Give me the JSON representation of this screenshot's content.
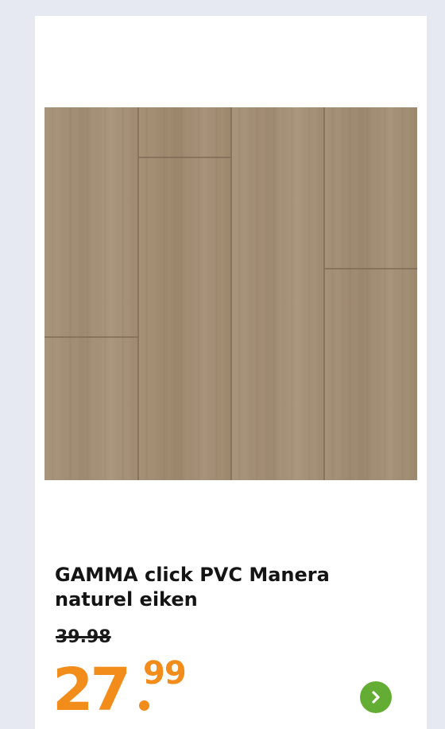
{
  "product": {
    "title_line1": "GAMMA click PVC Manera",
    "title_line2": "naturel eiken",
    "old_price": "39.98",
    "price_whole": "27",
    "price_cents": "99",
    "image_icon": "wood-floor-image"
  },
  "actions": {
    "next_icon": "chevron-right-icon"
  },
  "colors": {
    "price": "#f28c1a",
    "next_button": "#63ad34",
    "background": "#e6e9f1"
  }
}
